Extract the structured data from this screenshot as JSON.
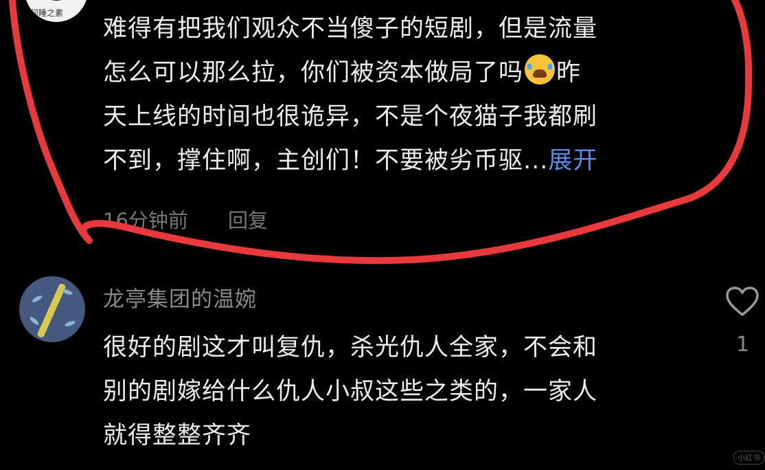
{
  "comments": [
    {
      "avatar_caption": "何睡之素",
      "lines": [
        "难得有把我们观众不当傻子的短剧，但是流量",
        "怎么可以那么拉，你们被资本做局了吗",
        "天上线的时间也很诡异，不是个夜猫子我都刷",
        "不到，撑住啊，主创们！不要被劣币驱..."
      ],
      "line2_tail": "昨",
      "emoji": "loudly-crying-face-icon",
      "expand_label": "展开",
      "time": "16分钟前",
      "reply_label": "回复"
    },
    {
      "username": "龙亭集团的温婉",
      "lines": [
        "很好的剧这才叫复仇，杀光仇人全家，不会和",
        "别的剧嫁给什么仇人小叔这些之类的，一家人",
        "就得整整齐齐"
      ],
      "like_icon": "heart-outline-icon",
      "like_count": "1"
    }
  ],
  "watermark": "小红书",
  "colors": {
    "background": "#000000",
    "annotation": "#e8393d",
    "link": "#5a8de8",
    "meta": "#777777"
  }
}
